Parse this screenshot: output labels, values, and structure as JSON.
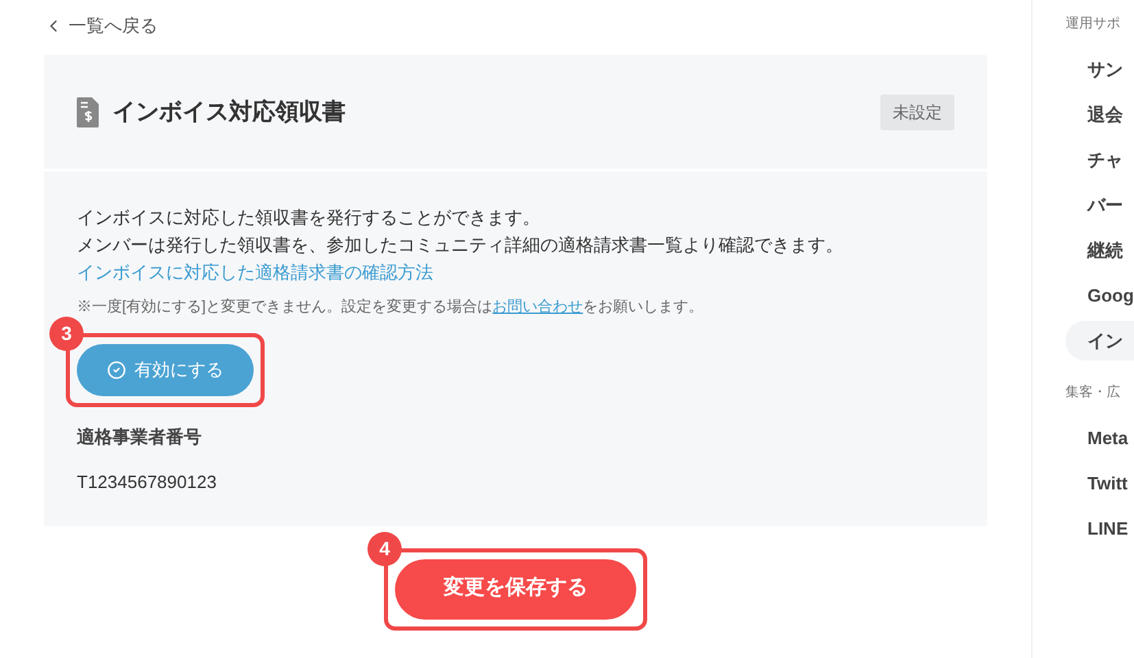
{
  "back_link": {
    "label": "一覧へ戻る"
  },
  "card": {
    "title": "インボイス対応領収書",
    "status_badge": "未設定",
    "description": [
      "インボイスに対応した領収書を発行することができます。",
      "メンバーは発行した領収書を、参加したコミュニティ詳細の適格請求書一覧より確認できます。"
    ],
    "help_link": "インボイスに対応した適格請求書の確認方法",
    "note": {
      "before": "※一度[有効にする]と変更できません。設定を変更する場合は",
      "link": "お問い合わせ",
      "after": "をお願いします。"
    },
    "enable_button": {
      "label": "有効にする",
      "callout": "3"
    },
    "field": {
      "label": "適格事業者番号",
      "value": "T1234567890123"
    }
  },
  "save_button": {
    "label": "変更を保存する",
    "callout": "4"
  },
  "sidebar": {
    "sections": [
      {
        "heading": "運用サポ",
        "items": [
          {
            "label": "サン",
            "selected": false
          },
          {
            "label": "退会",
            "selected": false
          },
          {
            "label": "チャ",
            "selected": false
          },
          {
            "label": "バー",
            "selected": false
          },
          {
            "label": "継続",
            "selected": false
          },
          {
            "label": "Goog",
            "selected": false
          },
          {
            "label": "イン",
            "selected": true
          }
        ]
      },
      {
        "heading": "集客・広",
        "items": [
          {
            "label": "Meta",
            "selected": false
          },
          {
            "label": "Twitt",
            "selected": false
          },
          {
            "label": "LINE",
            "selected": false
          }
        ]
      }
    ]
  }
}
